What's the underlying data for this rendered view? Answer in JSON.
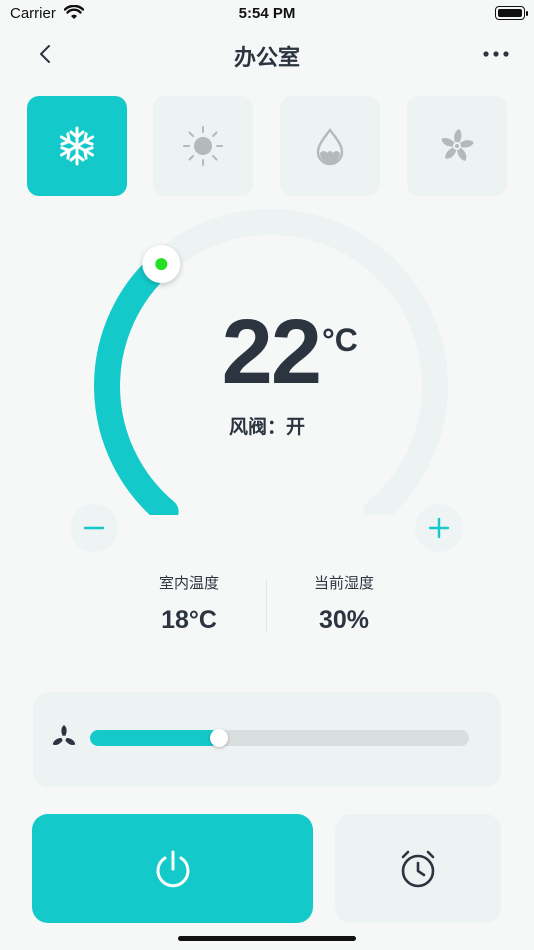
{
  "status_bar": {
    "carrier": "Carrier",
    "time": "5:54 PM"
  },
  "nav": {
    "title": "办公室"
  },
  "modes": [
    {
      "icon": "snowflake-icon",
      "active": true
    },
    {
      "icon": "sun-icon",
      "active": false
    },
    {
      "icon": "water-drop-icon",
      "active": false
    },
    {
      "icon": "fan-icon",
      "active": false
    }
  ],
  "thermostat": {
    "temperature": "22",
    "unit": "°C",
    "valve_status": "风阀：开",
    "dial_fill_fraction": 0.35
  },
  "stats": {
    "indoor_temp_label": "室内温度",
    "indoor_temp_value": "18°C",
    "humidity_label": "当前湿度",
    "humidity_value": "30%"
  },
  "fan_speed": {
    "level_fraction": 0.34
  },
  "colors": {
    "accent": "#13c9c9",
    "text": "#2c3440",
    "knob_dot": "#22e022",
    "panel": "#edf2f2"
  }
}
